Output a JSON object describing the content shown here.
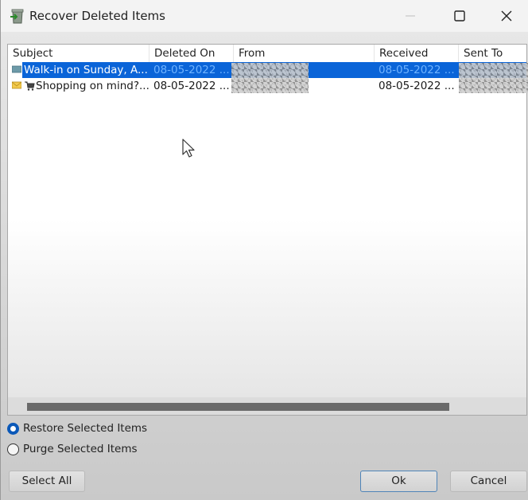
{
  "window": {
    "title": "Recover Deleted Items",
    "app_icon": "recycle-bin-icon",
    "controls": [
      "minimize-icon",
      "maximize-icon",
      "close-icon"
    ]
  },
  "list": {
    "columns": [
      "Subject",
      "Deleted On",
      "From",
      "Received",
      "Sent To"
    ],
    "rows": [
      {
        "icon": "meeting-request-icon",
        "subject": "Walk-in on Sunday, A...",
        "deleted_on": "08-05-2022 ...",
        "from": "[redacted]",
        "received": "08-05-2022 ...",
        "sent_to": "[redacted]",
        "selected": true
      },
      {
        "icon": "envelope-icon",
        "subject_prefix_icon": "shopping-cart-icon",
        "subject": "Shopping on mind?...",
        "deleted_on": "08-05-2022 ...",
        "from": "[redacted]",
        "received": "08-05-2022 ...",
        "sent_to": "[redacted]",
        "selected": false
      }
    ]
  },
  "options": {
    "restore_label": "Restore Selected Items",
    "purge_label": "Purge Selected Items",
    "selected": "restore"
  },
  "buttons": {
    "select_all": "Select All",
    "ok": "Ok",
    "cancel": "Cancel"
  }
}
